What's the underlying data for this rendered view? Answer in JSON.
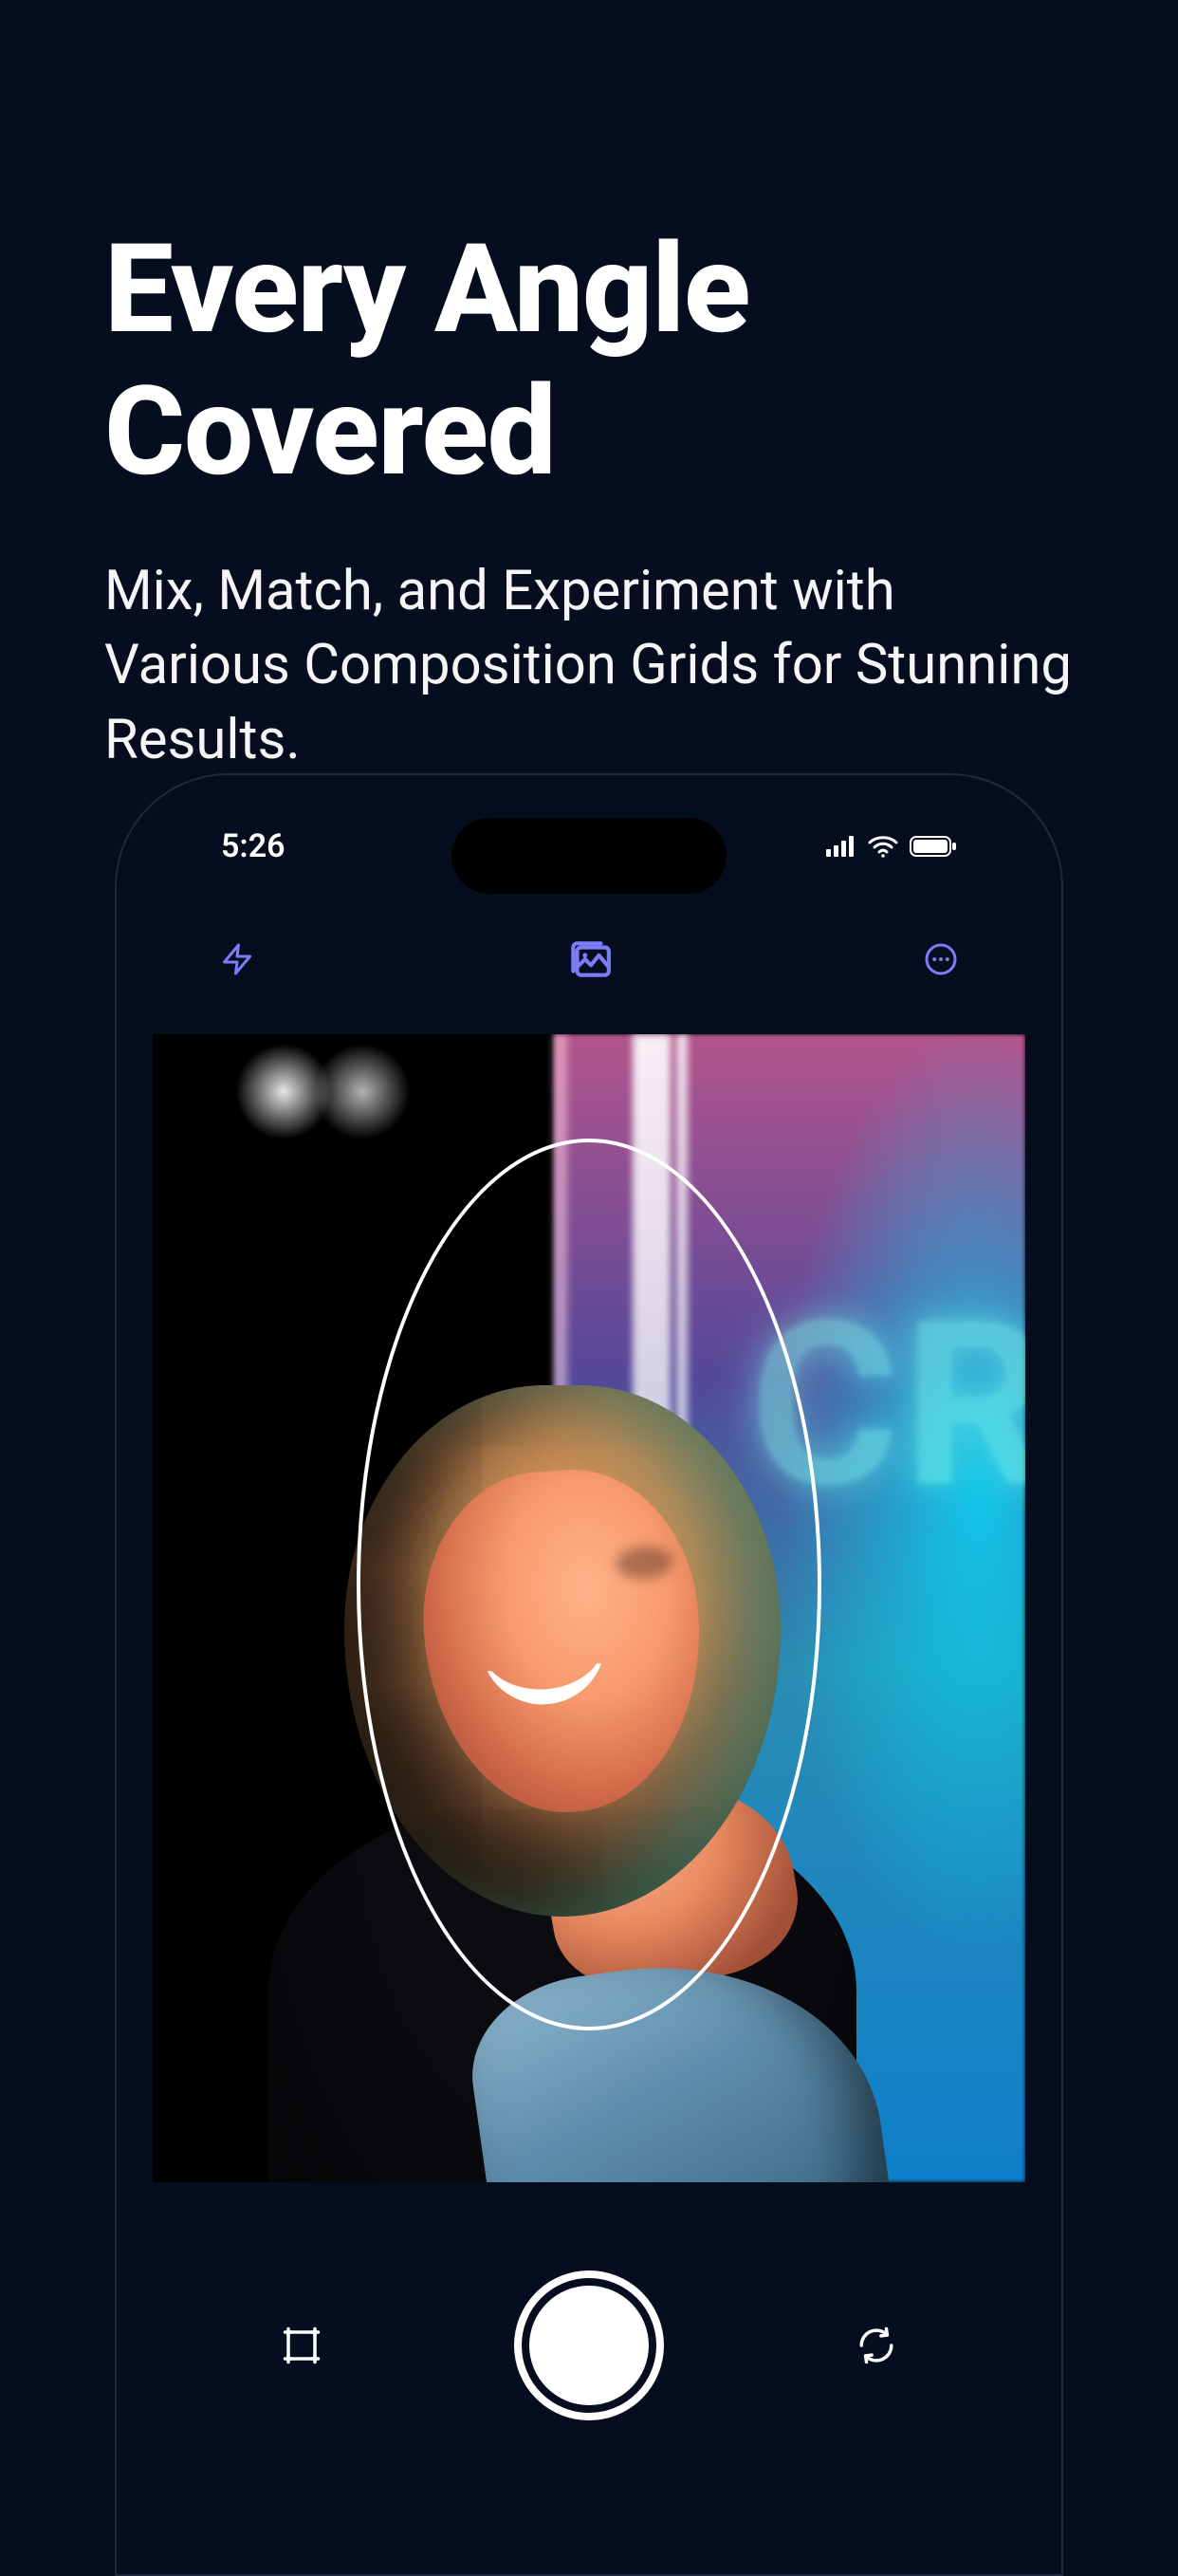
{
  "hero": {
    "title": "Every Angle Covered",
    "subtitle": "Mix, Match, and Experiment with Various Composition Grids for Stunning Results."
  },
  "status_bar": {
    "time": "5:26"
  },
  "toolbar": {
    "flash_icon": "flash",
    "gallery_icon": "image-stack",
    "more_icon": "more-horizontal"
  },
  "viewfinder": {
    "neon_text": "CR",
    "overlay_shape": "ellipse"
  },
  "bottom_controls": {
    "grid_icon": "crop-grid",
    "shutter": "capture",
    "switch_icon": "camera-switch"
  },
  "colors": {
    "background": "#050d1f",
    "accent": "#7c7cf7",
    "white": "#ffffff"
  }
}
